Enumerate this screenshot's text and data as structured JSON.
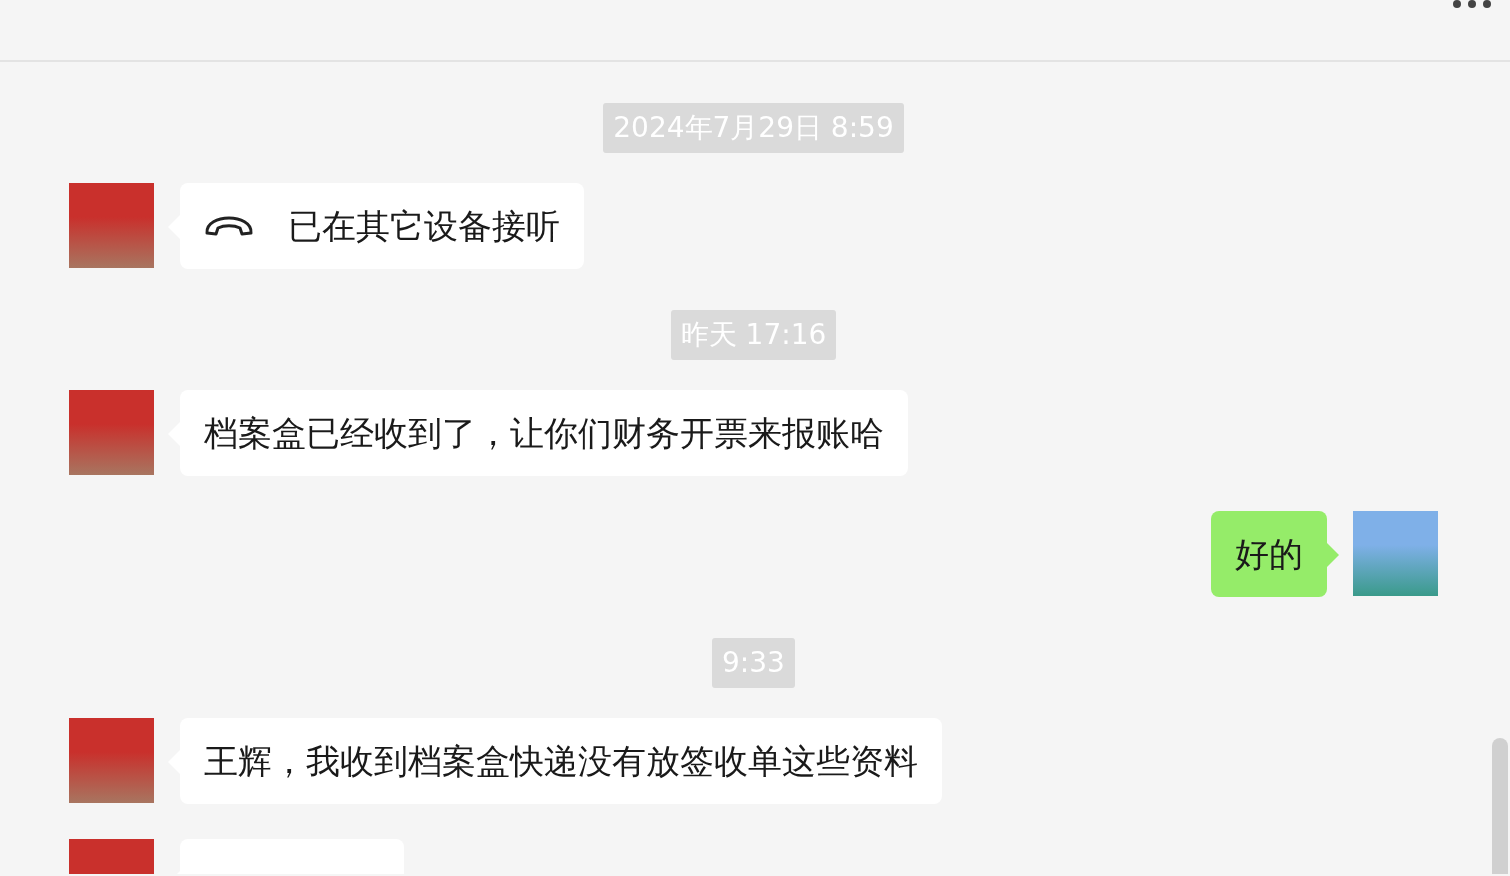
{
  "items": [
    {
      "kind": "time",
      "text": "2024年7月29日 8:59"
    },
    {
      "kind": "call",
      "outgoing": false,
      "text": "已在其它设备接听"
    },
    {
      "kind": "time",
      "text": "昨天 17:16"
    },
    {
      "kind": "text",
      "outgoing": false,
      "text": "档案盒已经收到了，让你们财务开票来报账哈"
    },
    {
      "kind": "text",
      "outgoing": true,
      "text": "好的"
    },
    {
      "kind": "time",
      "text": "9:33"
    },
    {
      "kind": "text",
      "outgoing": false,
      "text": "王辉，我收到档案盒快递没有放签收单这些资料"
    },
    {
      "kind": "text",
      "outgoing": false
    }
  ]
}
